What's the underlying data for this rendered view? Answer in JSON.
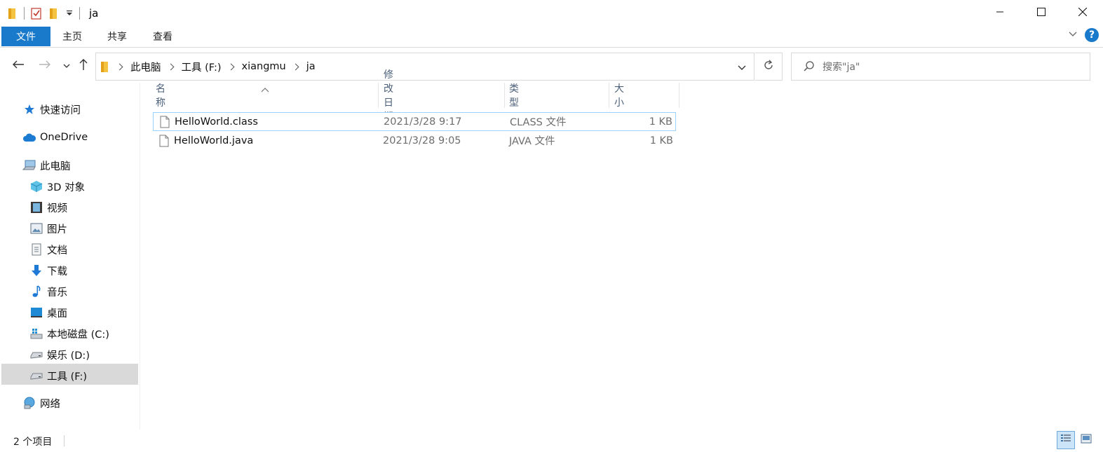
{
  "window": {
    "title": "ja",
    "controls": {
      "minimize_icon": "minimize-icon",
      "maximize_icon": "maximize-icon",
      "close_icon": "close-icon"
    }
  },
  "quick_access_toolbar": {
    "icons": [
      "folder-icon",
      "properties-check-icon",
      "new-folder-icon",
      "customize-dropdown-icon"
    ]
  },
  "ribbon": {
    "tabs": [
      {
        "label": "文件",
        "active": true
      },
      {
        "label": "主页"
      },
      {
        "label": "共享"
      },
      {
        "label": "查看"
      }
    ],
    "help_label": "?"
  },
  "address_bar": {
    "breadcrumbs": [
      "此电脑",
      "工具 (F:)",
      "xiangmu",
      "ja"
    ]
  },
  "search": {
    "placeholder": "搜索\"ja\""
  },
  "sidebar": {
    "items": [
      {
        "label": "快速访问",
        "icon": "star-icon"
      },
      {
        "label": "OneDrive",
        "icon": "cloud-icon"
      },
      {
        "label": "此电脑",
        "icon": "computer-icon"
      },
      {
        "label": "3D 对象",
        "icon": "cube-icon"
      },
      {
        "label": "视频",
        "icon": "film-icon"
      },
      {
        "label": "图片",
        "icon": "picture-icon"
      },
      {
        "label": "文档",
        "icon": "document-icon"
      },
      {
        "label": "下载",
        "icon": "download-arrow-icon"
      },
      {
        "label": "音乐",
        "icon": "music-note-icon"
      },
      {
        "label": "桌面",
        "icon": "desktop-icon"
      },
      {
        "label": "本地磁盘 (C:)",
        "icon": "windows-drive-icon"
      },
      {
        "label": "娱乐 (D:)",
        "icon": "drive-icon"
      },
      {
        "label": "工具 (F:)",
        "icon": "drive-icon",
        "selected": true
      },
      {
        "label": "网络",
        "icon": "network-icon"
      }
    ]
  },
  "file_list": {
    "columns": [
      "名称",
      "修改日期",
      "类型",
      "大小"
    ],
    "rows": [
      {
        "name": "HelloWorld.class",
        "modified": "2021/3/28 9:17",
        "type": "CLASS 文件",
        "size": "1 KB",
        "selected": true
      },
      {
        "name": "HelloWorld.java",
        "modified": "2021/3/28 9:05",
        "type": "JAVA 文件",
        "size": "1 KB"
      }
    ]
  },
  "status_bar": {
    "item_count": "2 个项目"
  },
  "colors": {
    "accent": "#1979ca",
    "selection_border": "#99d1ff",
    "nav_selected_bg": "#d9d9d9",
    "header_text": "#4c607a"
  }
}
